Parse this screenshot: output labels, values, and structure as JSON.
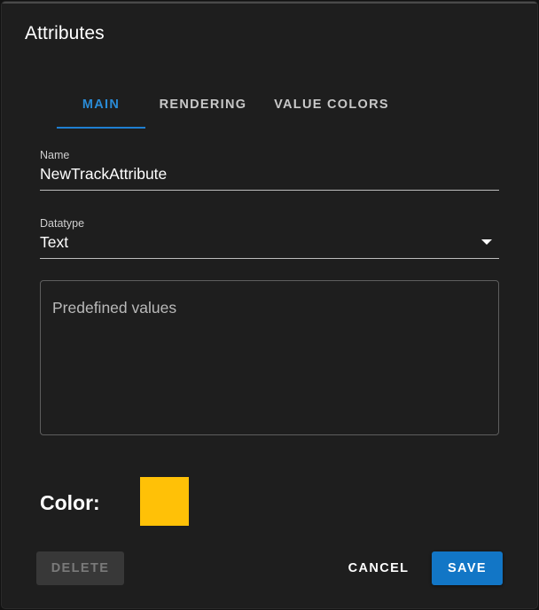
{
  "dialog": {
    "title": "Attributes"
  },
  "tabs": [
    {
      "label": "MAIN",
      "active": true
    },
    {
      "label": "RENDERING",
      "active": false
    },
    {
      "label": "VALUE COLORS",
      "active": false
    }
  ],
  "name_field": {
    "label": "Name",
    "value": "NewTrackAttribute"
  },
  "datatype_field": {
    "label": "Datatype",
    "value": "Text"
  },
  "predefined_values": {
    "placeholder": "Predefined values"
  },
  "color": {
    "label": "Color:",
    "value": "#ffc107"
  },
  "buttons": {
    "delete": "DELETE",
    "cancel": "CANCEL",
    "save": "SAVE"
  },
  "theme": {
    "accent": "#1f7fd1",
    "save_bg": "#1276c6",
    "background": "#1e1e1e"
  }
}
